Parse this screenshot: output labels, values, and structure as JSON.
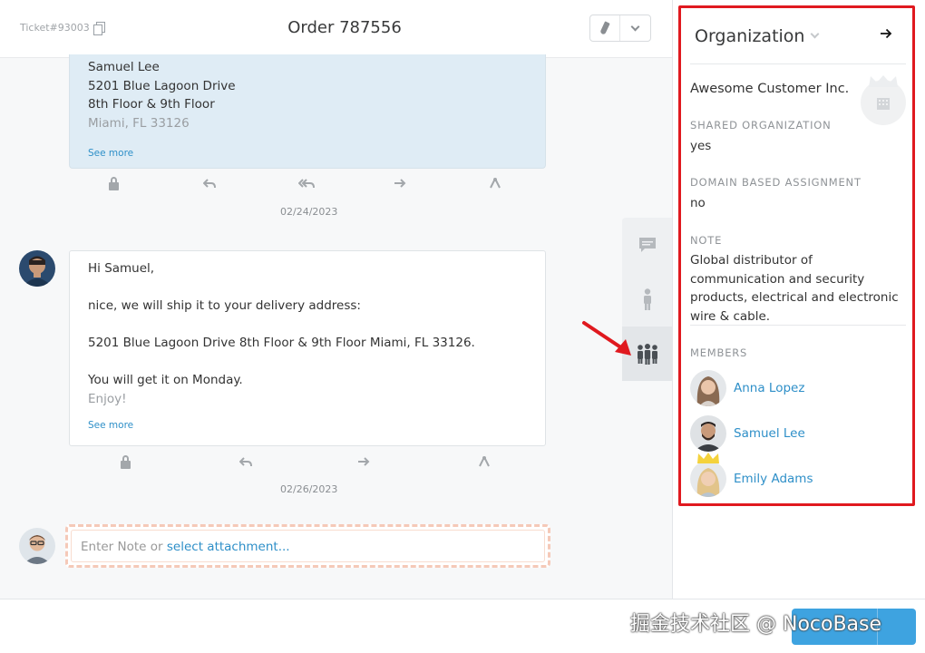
{
  "header": {
    "ticket_number": "Ticket#93003",
    "title": "Order 787556"
  },
  "articles": [
    {
      "lines": [
        "Samuel Lee",
        "5201 Blue Lagoon Drive",
        "8th Floor & 9th Floor"
      ],
      "faded_line": "Miami, FL 33126",
      "see_more": "See more",
      "date": "02/24/2023"
    },
    {
      "lines": [
        "Hi Samuel,",
        "",
        "nice, we will ship it to your delivery address:",
        "",
        "5201 Blue Lagoon Drive 8th Floor & 9th Floor Miami, FL 33126.",
        "",
        "You will get it on Monday."
      ],
      "faded_line": "Enjoy!",
      "see_more": "See more",
      "date": "02/26/2023"
    }
  ],
  "compose": {
    "placeholder_prefix": "Enter Note or ",
    "attachment_link": "select attachment..."
  },
  "sidebar": {
    "title": "Organization",
    "org_name": "Awesome Customer Inc.",
    "fields": [
      {
        "label": "SHARED ORGANIZATION",
        "value": "yes"
      },
      {
        "label": "DOMAIN BASED ASSIGNMENT",
        "value": "no"
      },
      {
        "label": "NOTE",
        "value": "Global distributor of communication and security products, electrical and electronic wire & cable."
      }
    ],
    "members_label": "MEMBERS",
    "members": [
      {
        "name": "Anna Lopez"
      },
      {
        "name": "Samuel Lee"
      },
      {
        "name": "Emily Adams"
      }
    ]
  },
  "watermark": "掘金技术社区 @ NocoBase",
  "colors": {
    "accent": "#2e8fc8",
    "highlight_border": "#e0191f",
    "internal_note_bg": "#dfecf5",
    "primary_button": "#3ea3e0"
  }
}
